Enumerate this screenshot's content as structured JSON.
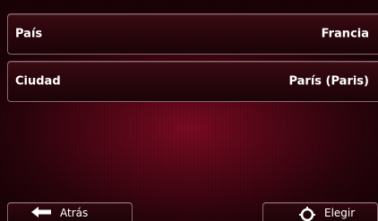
{
  "fields": [
    {
      "label": "País",
      "value": "Francia"
    },
    {
      "label": "Ciudad",
      "value": "París (Paris)"
    }
  ],
  "buttons": {
    "back_label": "Atrás",
    "back_icon": "arrow-left-icon",
    "choose_label": "Elegir",
    "choose_icon": "crosshair-icon"
  },
  "colors": {
    "background": "#4e0615",
    "row_border": "#8a6a6f",
    "text": "#ffffff"
  }
}
